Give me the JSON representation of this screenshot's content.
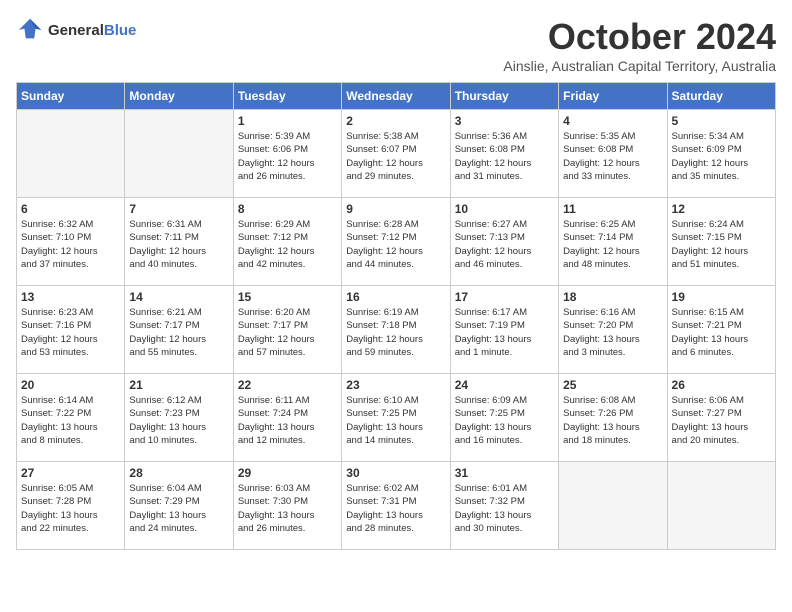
{
  "logo": {
    "line1": "General",
    "line2": "Blue"
  },
  "title": "October 2024",
  "subtitle": "Ainslie, Australian Capital Territory, Australia",
  "days_header": [
    "Sunday",
    "Monday",
    "Tuesday",
    "Wednesday",
    "Thursday",
    "Friday",
    "Saturday"
  ],
  "weeks": [
    [
      {
        "num": "",
        "detail": ""
      },
      {
        "num": "",
        "detail": ""
      },
      {
        "num": "1",
        "detail": "Sunrise: 5:39 AM\nSunset: 6:06 PM\nDaylight: 12 hours\nand 26 minutes."
      },
      {
        "num": "2",
        "detail": "Sunrise: 5:38 AM\nSunset: 6:07 PM\nDaylight: 12 hours\nand 29 minutes."
      },
      {
        "num": "3",
        "detail": "Sunrise: 5:36 AM\nSunset: 6:08 PM\nDaylight: 12 hours\nand 31 minutes."
      },
      {
        "num": "4",
        "detail": "Sunrise: 5:35 AM\nSunset: 6:08 PM\nDaylight: 12 hours\nand 33 minutes."
      },
      {
        "num": "5",
        "detail": "Sunrise: 5:34 AM\nSunset: 6:09 PM\nDaylight: 12 hours\nand 35 minutes."
      }
    ],
    [
      {
        "num": "6",
        "detail": "Sunrise: 6:32 AM\nSunset: 7:10 PM\nDaylight: 12 hours\nand 37 minutes."
      },
      {
        "num": "7",
        "detail": "Sunrise: 6:31 AM\nSunset: 7:11 PM\nDaylight: 12 hours\nand 40 minutes."
      },
      {
        "num": "8",
        "detail": "Sunrise: 6:29 AM\nSunset: 7:12 PM\nDaylight: 12 hours\nand 42 minutes."
      },
      {
        "num": "9",
        "detail": "Sunrise: 6:28 AM\nSunset: 7:12 PM\nDaylight: 12 hours\nand 44 minutes."
      },
      {
        "num": "10",
        "detail": "Sunrise: 6:27 AM\nSunset: 7:13 PM\nDaylight: 12 hours\nand 46 minutes."
      },
      {
        "num": "11",
        "detail": "Sunrise: 6:25 AM\nSunset: 7:14 PM\nDaylight: 12 hours\nand 48 minutes."
      },
      {
        "num": "12",
        "detail": "Sunrise: 6:24 AM\nSunset: 7:15 PM\nDaylight: 12 hours\nand 51 minutes."
      }
    ],
    [
      {
        "num": "13",
        "detail": "Sunrise: 6:23 AM\nSunset: 7:16 PM\nDaylight: 12 hours\nand 53 minutes."
      },
      {
        "num": "14",
        "detail": "Sunrise: 6:21 AM\nSunset: 7:17 PM\nDaylight: 12 hours\nand 55 minutes."
      },
      {
        "num": "15",
        "detail": "Sunrise: 6:20 AM\nSunset: 7:17 PM\nDaylight: 12 hours\nand 57 minutes."
      },
      {
        "num": "16",
        "detail": "Sunrise: 6:19 AM\nSunset: 7:18 PM\nDaylight: 12 hours\nand 59 minutes."
      },
      {
        "num": "17",
        "detail": "Sunrise: 6:17 AM\nSunset: 7:19 PM\nDaylight: 13 hours\nand 1 minute."
      },
      {
        "num": "18",
        "detail": "Sunrise: 6:16 AM\nSunset: 7:20 PM\nDaylight: 13 hours\nand 3 minutes."
      },
      {
        "num": "19",
        "detail": "Sunrise: 6:15 AM\nSunset: 7:21 PM\nDaylight: 13 hours\nand 6 minutes."
      }
    ],
    [
      {
        "num": "20",
        "detail": "Sunrise: 6:14 AM\nSunset: 7:22 PM\nDaylight: 13 hours\nand 8 minutes."
      },
      {
        "num": "21",
        "detail": "Sunrise: 6:12 AM\nSunset: 7:23 PM\nDaylight: 13 hours\nand 10 minutes."
      },
      {
        "num": "22",
        "detail": "Sunrise: 6:11 AM\nSunset: 7:24 PM\nDaylight: 13 hours\nand 12 minutes."
      },
      {
        "num": "23",
        "detail": "Sunrise: 6:10 AM\nSunset: 7:25 PM\nDaylight: 13 hours\nand 14 minutes."
      },
      {
        "num": "24",
        "detail": "Sunrise: 6:09 AM\nSunset: 7:25 PM\nDaylight: 13 hours\nand 16 minutes."
      },
      {
        "num": "25",
        "detail": "Sunrise: 6:08 AM\nSunset: 7:26 PM\nDaylight: 13 hours\nand 18 minutes."
      },
      {
        "num": "26",
        "detail": "Sunrise: 6:06 AM\nSunset: 7:27 PM\nDaylight: 13 hours\nand 20 minutes."
      }
    ],
    [
      {
        "num": "27",
        "detail": "Sunrise: 6:05 AM\nSunset: 7:28 PM\nDaylight: 13 hours\nand 22 minutes."
      },
      {
        "num": "28",
        "detail": "Sunrise: 6:04 AM\nSunset: 7:29 PM\nDaylight: 13 hours\nand 24 minutes."
      },
      {
        "num": "29",
        "detail": "Sunrise: 6:03 AM\nSunset: 7:30 PM\nDaylight: 13 hours\nand 26 minutes."
      },
      {
        "num": "30",
        "detail": "Sunrise: 6:02 AM\nSunset: 7:31 PM\nDaylight: 13 hours\nand 28 minutes."
      },
      {
        "num": "31",
        "detail": "Sunrise: 6:01 AM\nSunset: 7:32 PM\nDaylight: 13 hours\nand 30 minutes."
      },
      {
        "num": "",
        "detail": ""
      },
      {
        "num": "",
        "detail": ""
      }
    ]
  ]
}
